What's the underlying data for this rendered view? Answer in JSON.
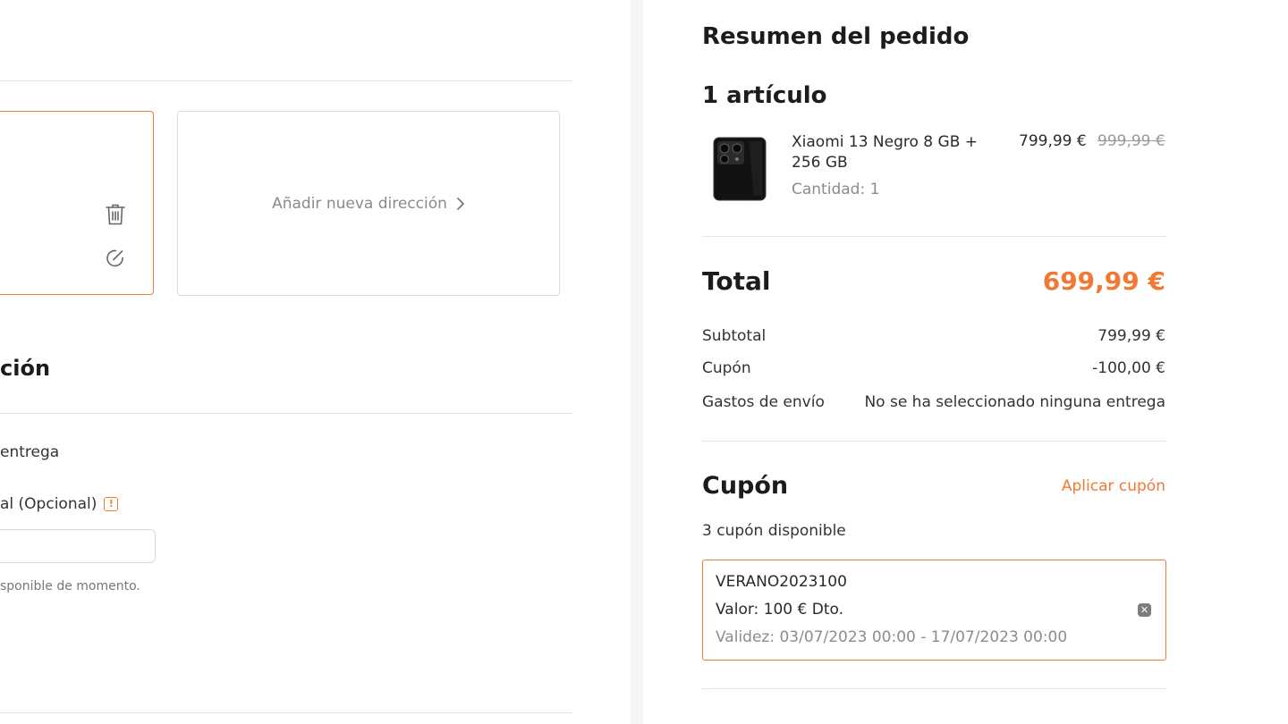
{
  "colors": {
    "accent": "#f07a34",
    "divider": "#e4e4e4"
  },
  "left": {
    "new_address_label": "Añadir nueva dirección",
    "section_heading_partial": "ción",
    "delivery_text_partial": "entrega",
    "optional_label_partial": "al (Opcional)",
    "availability_note_partial": "sponible de momento.",
    "icons": {
      "delete": "trash-icon",
      "edit": "edit-icon",
      "chevron": "chevron-right-icon",
      "info": "info-icon"
    }
  },
  "summary": {
    "title": "Resumen del pedido",
    "items_count": "1 artículo",
    "product": {
      "name": "Xiaomi 13 Negro 8 GB + 256 GB",
      "quantity": "Cantidad: 1",
      "price": "799,99 €",
      "old_price": "999,99 €"
    },
    "total_label": "Total",
    "total_value": "699,99 €",
    "rows": [
      {
        "label": "Subtotal",
        "value": "799,99 €"
      },
      {
        "label": "Cupón",
        "value": "-100,00 €"
      },
      {
        "label": "Gastos de envío",
        "value": "No se ha seleccionado ninguna entrega"
      }
    ]
  },
  "coupon": {
    "heading": "Cupón",
    "apply_label": "Aplicar cupón",
    "available": "3 cupón disponible",
    "code": "VERANO2023100",
    "value": "Valor: 100 € Dto.",
    "validity": "Validez: 03/07/2023 00:00 - 17/07/2023 00:00",
    "remove_icon": "close-icon"
  }
}
